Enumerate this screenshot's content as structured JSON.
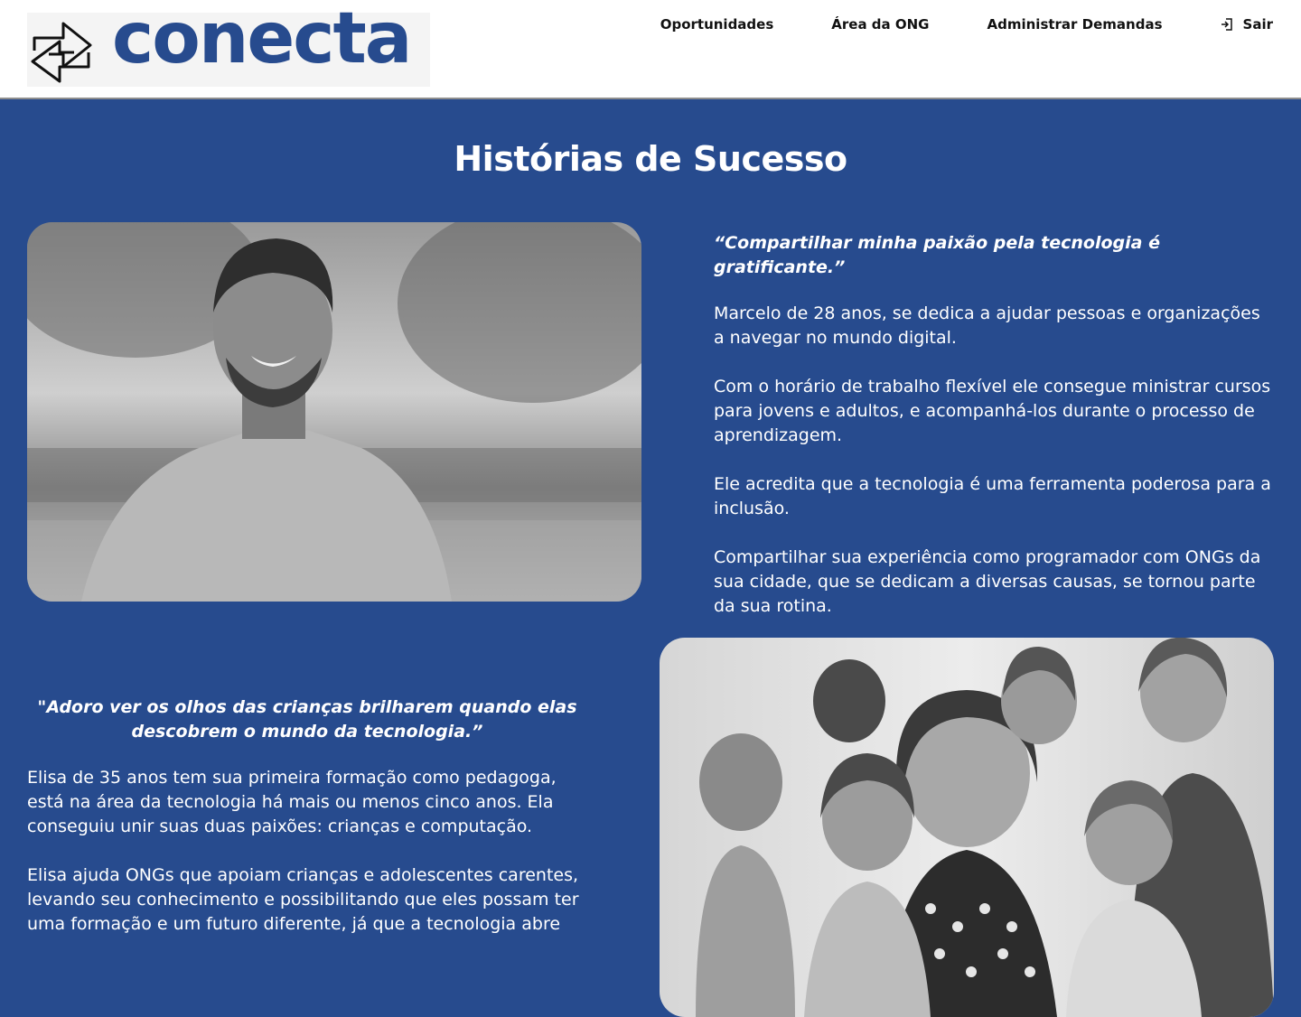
{
  "brand": {
    "name": "conecta",
    "color": "#274b8e"
  },
  "nav": {
    "items": [
      {
        "label": "Oportunidades"
      },
      {
        "label": "Área da ONG"
      },
      {
        "label": "Administrar Demandas"
      },
      {
        "label": "Sair",
        "icon": "logout-icon"
      }
    ]
  },
  "page": {
    "title": "Histórias de Sucesso",
    "background": "#274b8e"
  },
  "stories": [
    {
      "quote": "“Compartilhar minha paixão pela tecnologia é gratificante.”",
      "paragraphs": [
        "Marcelo de 28 anos, se dedica a ajudar pessoas e organizações a navegar no mundo digital.",
        "Com o horário de trabalho flexível ele consegue ministrar cursos para jovens e adultos, e acompanhá-los durante o processo de aprendizagem.",
        "Ele acredita que a tecnologia é uma ferramenta poderosa para a inclusão.",
        "Compartilhar sua experiência como programador com ONGs da sua cidade, que se dedicam a diversas causas, se tornou parte da sua rotina."
      ]
    },
    {
      "quote": "\"Adoro ver os olhos das crianças brilharem quando elas descobrem o mundo da tecnologia.”",
      "paragraphs": [
        "Elisa de 35 anos tem sua primeira formação como pedagoga, está na área da tecnologia há mais ou menos cinco anos. Ela conseguiu unir suas duas paixões: crianças e computação.",
        "Elisa ajuda ONGs que apoiam crianças e adolescentes carentes, levando seu conhecimento e possibilitando que eles possam ter uma formação e um futuro diferente, já que a tecnologia abre"
      ]
    }
  ]
}
